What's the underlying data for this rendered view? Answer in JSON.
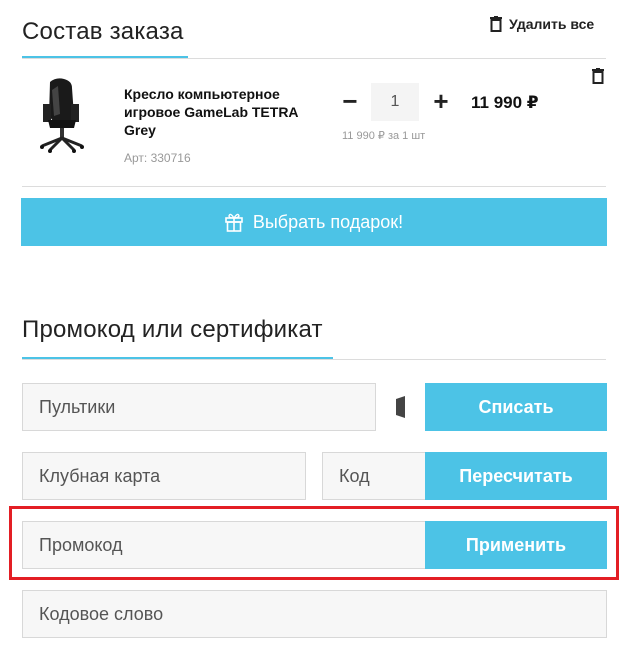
{
  "order": {
    "title": "Состав заказа",
    "delete_all_label": "Удалить все"
  },
  "product": {
    "name_line1": "Кресло компьютерное",
    "name_line2": "игровое GameLab TETRA",
    "name_line3": "Grey",
    "sku": "Арт: 330716",
    "quantity": "1",
    "minus": "−",
    "plus": "+",
    "price": "11 990 ₽",
    "unit_price": "11 990 ₽ за 1 шт"
  },
  "gift": {
    "label": "Выбрать подарок!"
  },
  "promo": {
    "title": "Промокод или сертификат",
    "pultiki_placeholder": "Пультики",
    "pultiki_button": "Списать",
    "club_card_placeholder": "Клубная карта",
    "code_placeholder": "Код",
    "recalc_button": "Пересчитать",
    "promocode_placeholder": "Промокод",
    "apply_button": "Применить",
    "codeword_placeholder": "Кодовое слово"
  },
  "colors": {
    "accent": "#4cc3e6",
    "highlight": "#e31e24"
  }
}
